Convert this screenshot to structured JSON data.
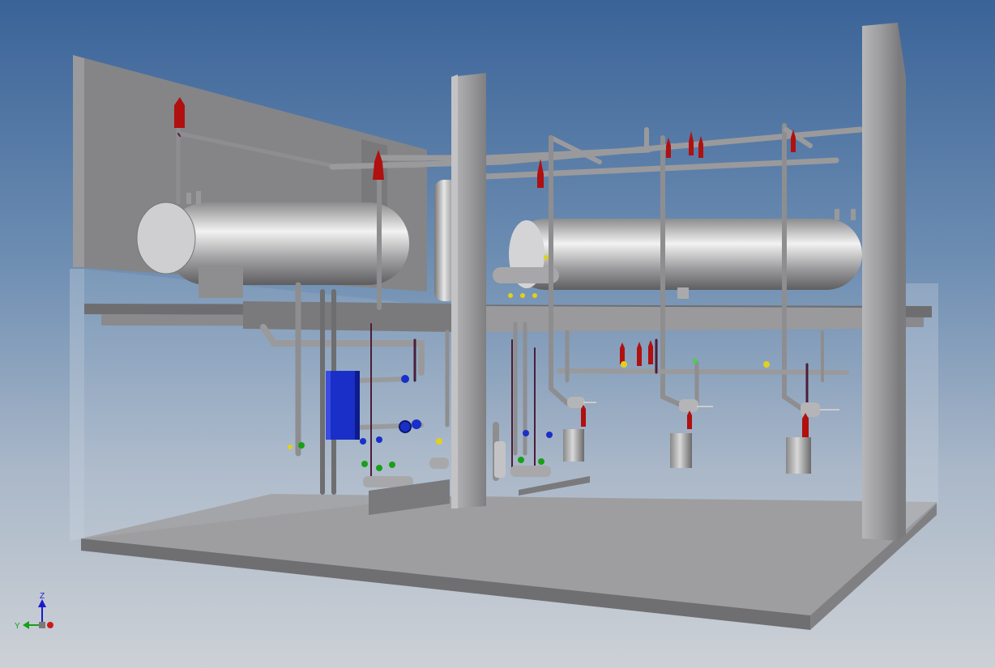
{
  "viewport": {
    "background_top": "#3a6398",
    "background_bottom": "#cdd1d6"
  },
  "view_cube_triad": {
    "z_label": "Z",
    "y_label": "Y",
    "z_color": "#1a1acc",
    "y_color": "#18a018",
    "x_color": "#cc1a1a"
  },
  "scene": {
    "description_items": [
      "concrete-floor-slab",
      "rear-wall-panel",
      "steel-columns",
      "pipe-rack-beam",
      "horizontal-vessel-left",
      "horizontal-vessel-right",
      "vertical-vessel",
      "plate-heat-exchanger",
      "pumps",
      "condensate-pots",
      "safety-valves",
      "piping"
    ],
    "colors": {
      "steel": "#9a9a9c",
      "vessel": "#c8c8ca",
      "heat_exchanger": "#1a2fc8",
      "safety_valve": "#b01010",
      "pipe_trace": "#4a1d3a",
      "glass_enclosure": "#cfd8e2"
    }
  }
}
